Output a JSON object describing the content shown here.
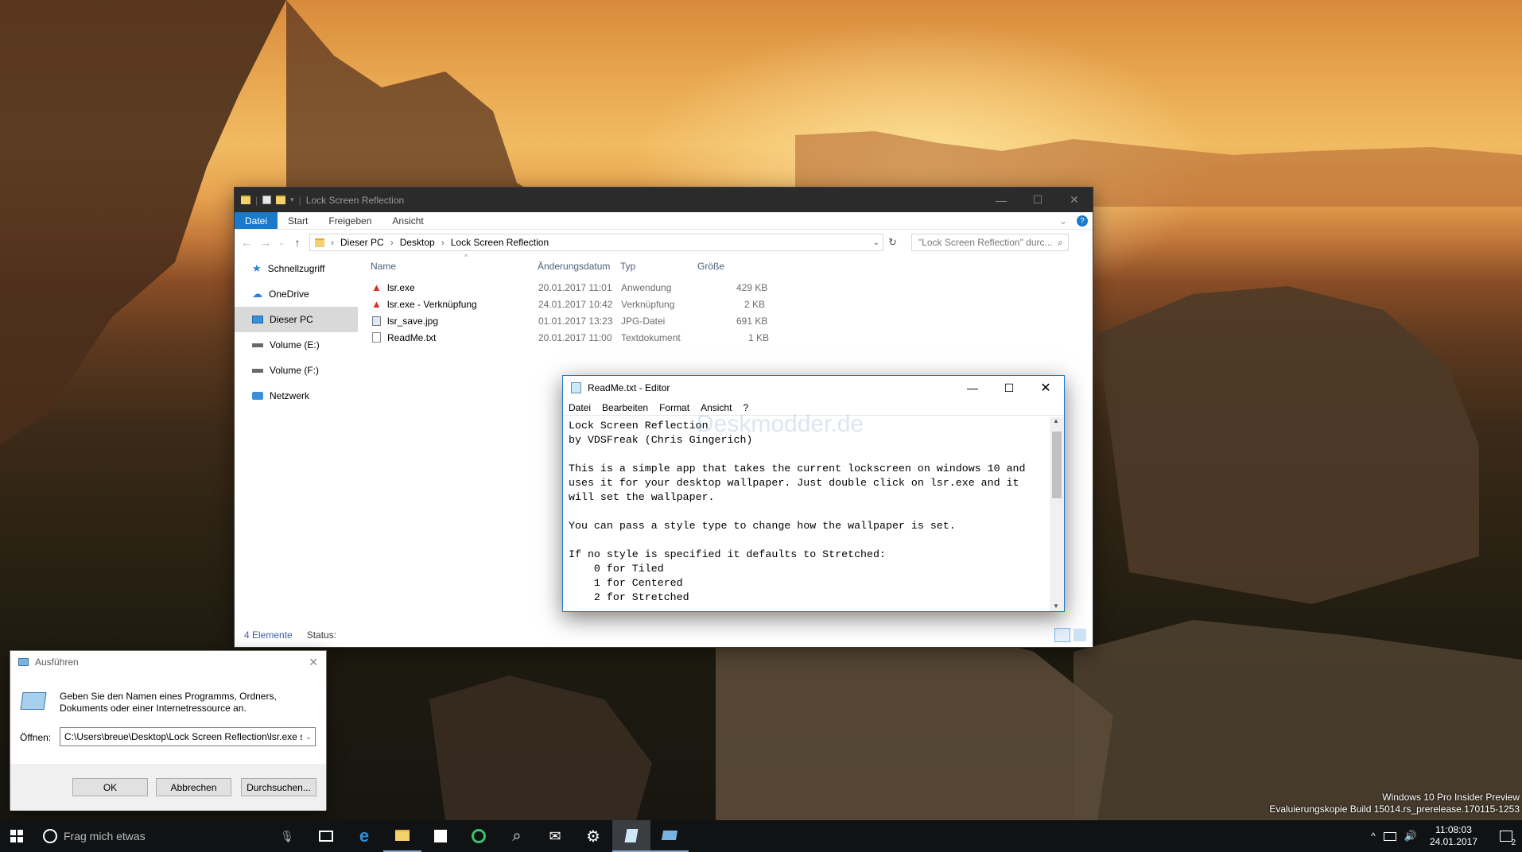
{
  "explorer": {
    "title": "Lock Screen Reflection",
    "ribbon_tabs": [
      "Datei",
      "Start",
      "Freigeben",
      "Ansicht"
    ],
    "address": [
      "Dieser PC",
      "Desktop",
      "Lock Screen Reflection"
    ],
    "search_placeholder": "\"Lock Screen Reflection\" durc...",
    "nav_items": [
      "Schnellzugriff",
      "OneDrive",
      "Dieser PC",
      "Volume (E:)",
      "Volume (F:)",
      "Netzwerk"
    ],
    "columns": {
      "name": "Name",
      "date": "Änderungsdatum",
      "type": "Typ",
      "size": "Größe"
    },
    "files": [
      {
        "name": "lsr.exe",
        "date": "20.01.2017 11:01",
        "type": "Anwendung",
        "size": "429 KB"
      },
      {
        "name": "lsr.exe - Verknüpfung",
        "date": "24.01.2017 10:42",
        "type": "Verknüpfung",
        "size": "2 KB"
      },
      {
        "name": "lsr_save.jpg",
        "date": "01.01.2017 13:23",
        "type": "JPG-Datei",
        "size": "691 KB"
      },
      {
        "name": "ReadMe.txt",
        "date": "20.01.2017 11:00",
        "type": "Textdokument",
        "size": "1 KB"
      }
    ],
    "status_count": "4 Elemente",
    "status_label": "Status:"
  },
  "notepad": {
    "title": "ReadMe.txt - Editor",
    "menu": [
      "Datei",
      "Bearbeiten",
      "Format",
      "Ansicht",
      "?"
    ],
    "watermark": "Deskmodder.de",
    "lines": [
      "Lock Screen Reflection",
      "by VDSFreak (Chris Gingerich)",
      "",
      "This is a simple app that takes the current lockscreen on windows 10 and",
      "uses it for your desktop wallpaper. Just double click on lsr.exe and it",
      "will set the wallpaper.",
      "",
      "You can pass a style type to change how the wallpaper is set.",
      "",
      "If no style is specified it defaults to Stretched:",
      "    0 for Tiled",
      "    1 for Centered",
      "    2 for Stretched"
    ]
  },
  "run": {
    "title": "Ausführen",
    "description": "Geben Sie den Namen eines Programms, Ordners, Dokuments oder einer Internetressource an.",
    "open_label": "Öffnen:",
    "open_value": "C:\\Users\\breue\\Desktop\\Lock Screen Reflection\\lsr.exe s",
    "ok": "OK",
    "cancel": "Abbrechen",
    "browse": "Durchsuchen..."
  },
  "taskbar": {
    "search_placeholder": "Frag mich etwas",
    "time": "11:08:03",
    "date": "24.01.2017",
    "notifications": "2"
  },
  "watermark_build": {
    "line1": "Windows 10 Pro Insider Preview",
    "line2": "Evaluierungskopie Build 15014.rs_prerelease.170115-1253"
  },
  "colors": {
    "accent": "#1979ca",
    "titlebar_dark": "#2b2b2b",
    "taskbar": "#101214"
  }
}
